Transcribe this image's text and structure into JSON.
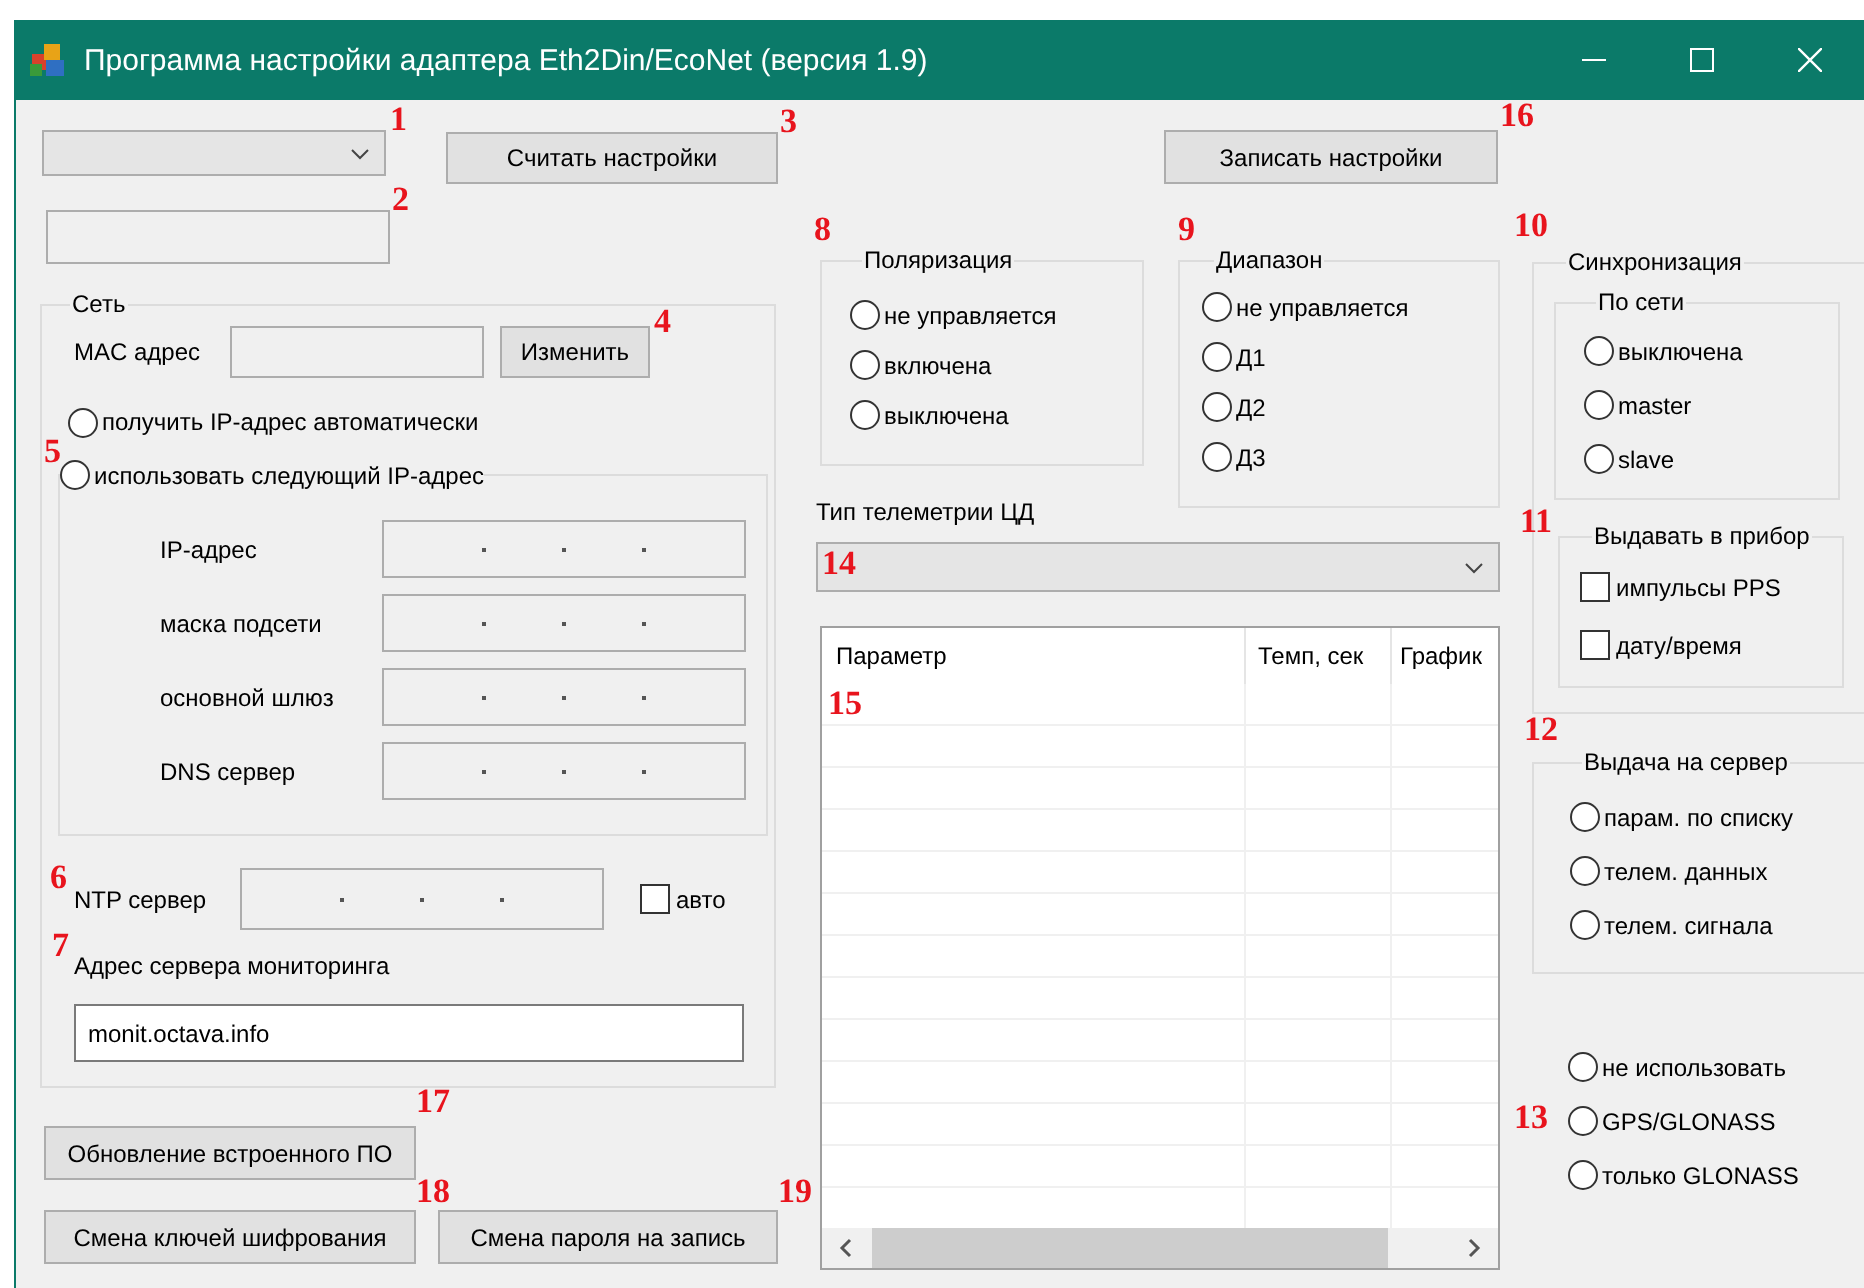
{
  "window": {
    "title": "Программа настройки адаптера Eth2Din/EcoNet (версия 1.9)"
  },
  "device_buttons": {
    "read": "Считать настройки",
    "write": "Записать настройки"
  },
  "network": {
    "title": "Сеть",
    "mac_label": "MAC адрес",
    "change_button": "Изменить",
    "ip_modes": [
      {
        "label": "получить IP-адрес автоматически",
        "selected": false
      },
      {
        "label": "использовать следующий IP-адрес",
        "selected": false
      }
    ],
    "ip_fields": [
      {
        "label": "IP-адрес"
      },
      {
        "label": "маска подсети"
      },
      {
        "label": "основной шлюз"
      },
      {
        "label": "DNS сервер"
      }
    ],
    "ntp": {
      "label": "NTP сервер",
      "auto": {
        "label": "авто",
        "checked": false
      }
    },
    "monitoring": {
      "label": "Адрес сервера мониторинга",
      "value": "monit.octava.info"
    }
  },
  "polarization": {
    "title": "Поляризация",
    "options": [
      {
        "label": "не управляется",
        "selected": false
      },
      {
        "label": "включена",
        "selected": false
      },
      {
        "label": "выключена",
        "selected": false
      }
    ]
  },
  "range": {
    "title": "Диапазон",
    "options": [
      {
        "label": "не управляется",
        "selected": false
      },
      {
        "label": "Д1",
        "selected": false
      },
      {
        "label": "Д2",
        "selected": false
      },
      {
        "label": "Д3",
        "selected": false
      }
    ]
  },
  "telemetry": {
    "label": "Тип телеметрии ЦД"
  },
  "table": {
    "columns": [
      "Параметр",
      "Темп, сек",
      "График"
    ]
  },
  "sync": {
    "title": "Синхронизация",
    "network": {
      "title": "По сети",
      "options": [
        {
          "label": "выключена",
          "selected": false
        },
        {
          "label": "master",
          "selected": false
        },
        {
          "label": "slave",
          "selected": false
        }
      ]
    },
    "output": {
      "title": "Выдавать в прибор",
      "options": [
        {
          "label": "импульсы PPS",
          "checked": false
        },
        {
          "label": "дату/время",
          "checked": false
        }
      ]
    }
  },
  "server_output": {
    "title": "Выдача на сервер",
    "options": [
      {
        "label": "парам. по списку",
        "selected": false
      },
      {
        "label": "телем. данных",
        "selected": false
      },
      {
        "label": "телем. сигнала",
        "selected": false
      }
    ]
  },
  "gnss": {
    "options": [
      {
        "label": "не использовать",
        "selected": false
      },
      {
        "label": "GPS/GLONASS",
        "selected": false
      },
      {
        "label": "только GLONASS",
        "selected": false
      }
    ]
  },
  "bottom_buttons": [
    "Обновление встроенного ПО",
    "Смена ключей шифрования",
    "Смена пароля на запись"
  ],
  "annotations": [
    "1",
    "2",
    "3",
    "4",
    "5",
    "6",
    "7",
    "8",
    "9",
    "10",
    "11",
    "12",
    "13",
    "14",
    "15",
    "16",
    "17",
    "18",
    "19"
  ]
}
